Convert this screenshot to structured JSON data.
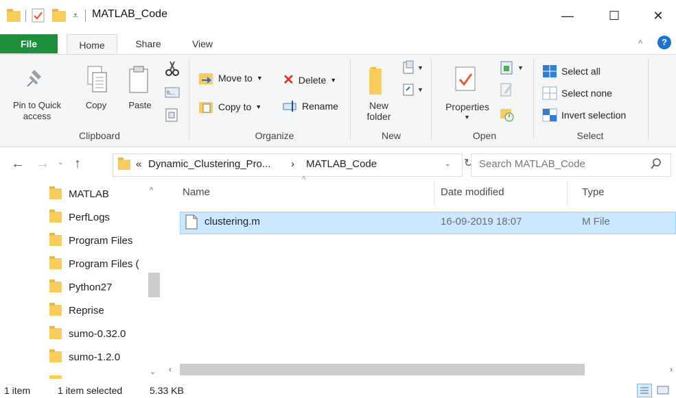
{
  "window": {
    "title": "MATLAB_Code",
    "min_glyph": "—",
    "max_glyph": "☐",
    "close_glyph": "✕"
  },
  "ribbon_tabs": [
    "File",
    "Home",
    "Share",
    "View"
  ],
  "clipboard": {
    "pin_label": "Pin to Quick access",
    "copy_label": "Copy",
    "paste_label": "Paste",
    "group_label": "Clipboard"
  },
  "organize": {
    "move_to": "Move to",
    "copy_to": "Copy to",
    "delete": "Delete",
    "rename": "Rename",
    "group_label": "Organize"
  },
  "new": {
    "new_folder": "New folder",
    "group_label": "New"
  },
  "open": {
    "properties": "Properties",
    "group_label": "Open"
  },
  "select": {
    "select_all": "Select all",
    "select_none": "Select none",
    "invert": "Invert selection",
    "group_label": "Select"
  },
  "address": {
    "prefix": "«",
    "parent": "Dynamic_Clustering_Pro...",
    "separator": "›",
    "current": "MATLAB_Code"
  },
  "search": {
    "placeholder": "Search MATLAB_Code"
  },
  "nav_pane": [
    "MATLAB",
    "PerfLogs",
    "Program Files",
    "Program Files (",
    "Python27",
    "Reprise",
    "sumo-0.32.0",
    "sumo-1.2.0"
  ],
  "columns": {
    "name": "Name",
    "date": "Date modified",
    "type": "Type"
  },
  "files": [
    {
      "name": "clustering.m",
      "date": "16-09-2019 18:07",
      "type": "M File",
      "selected": true
    }
  ],
  "status": {
    "count": "1 item",
    "selection": "1 item selected",
    "size": "5.33 KB"
  },
  "colors": {
    "file_tab": "#1e8f3a",
    "selection": "#cce8ff",
    "folder": "#f8cd5c"
  }
}
